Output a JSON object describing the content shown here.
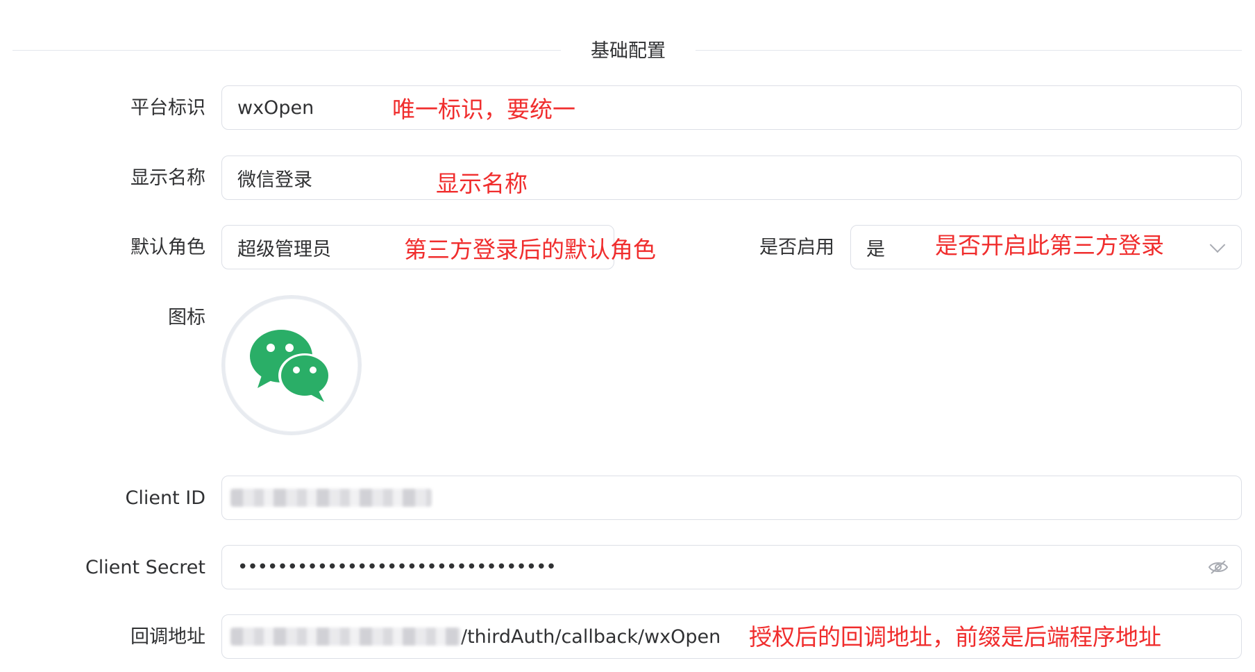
{
  "section": {
    "title": "基础配置"
  },
  "form": {
    "platform_id": {
      "label": "平台标识",
      "value": "wxOpen",
      "note": "唯一标识，要统一"
    },
    "display_name": {
      "label": "显示名称",
      "value": "微信登录",
      "note": "显示名称"
    },
    "default_role": {
      "label": "默认角色",
      "value": "超级管理员",
      "note": "第三方登录后的默认角色"
    },
    "enabled": {
      "label": "是否启用",
      "value": "是",
      "note": "是否开启此第三方登录"
    },
    "icon": {
      "label": "图标",
      "icon_name": "wechat-icon",
      "icon_color": "#2aae67"
    },
    "client_id": {
      "label": "Client ID"
    },
    "client_secret": {
      "label": "Client Secret",
      "value": "••••••••••••••••••••••••••••••••"
    },
    "callback_url": {
      "label": "回调地址",
      "value_suffix": "/thirdAuth/callback/wxOpen",
      "note": "授权后的回调地址，前缀是后端程序地址"
    }
  },
  "colors": {
    "annotation": "#f02d2d",
    "border": "#dcdfe6",
    "text": "#303133"
  }
}
